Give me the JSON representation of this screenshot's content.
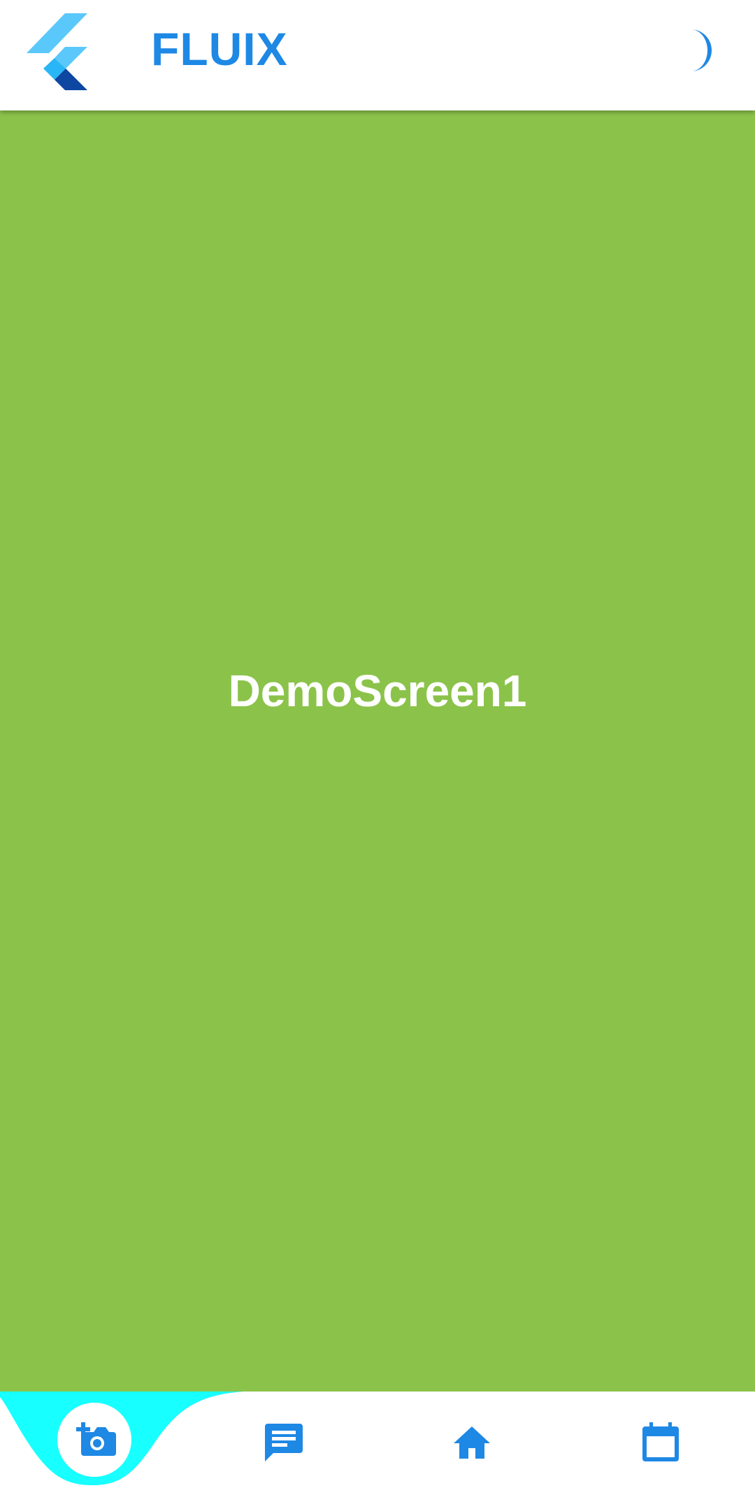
{
  "appbar": {
    "title": "FLUIX",
    "logo_icon": "flutter-logo-icon",
    "theme_toggle_icon": "moon-icon"
  },
  "main": {
    "screen_label": "DemoScreen1",
    "background_color": "#8bc34a"
  },
  "bottom_nav": {
    "items": [
      {
        "icon": "add-camera-icon",
        "active": true
      },
      {
        "icon": "message-icon",
        "active": false
      },
      {
        "icon": "home-icon",
        "active": false
      },
      {
        "icon": "calendar-icon",
        "active": false
      }
    ],
    "active_highlight_color": "#18ffff",
    "icon_color": "#1e88e5"
  }
}
